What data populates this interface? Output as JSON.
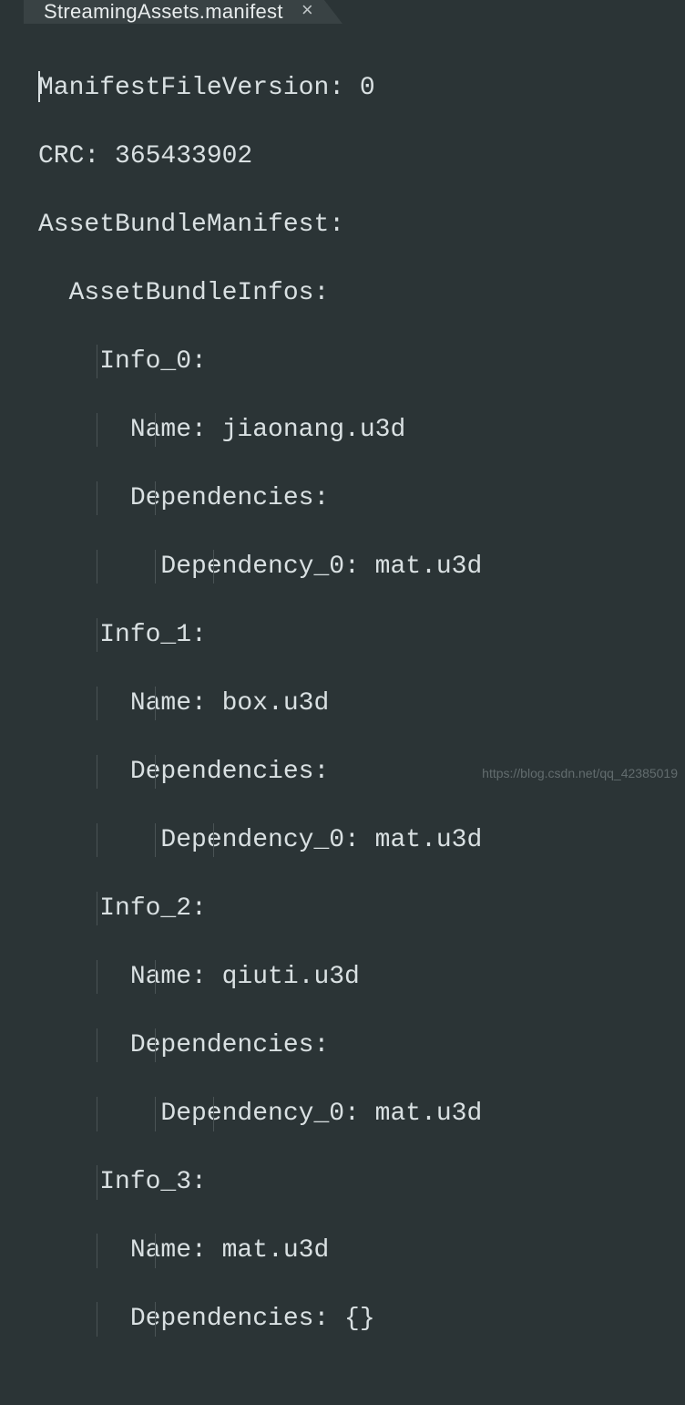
{
  "tab": {
    "title": "StreamingAssets.manifest",
    "close_icon": "×"
  },
  "content": {
    "l1": "ManifestFileVersion: 0",
    "l2": "CRC: 365433902",
    "l3": "AssetBundleManifest:",
    "l4": "  AssetBundleInfos:",
    "l5": "    Info_0:",
    "l6": "      Name: jiaonang.u3d",
    "l7": "      Dependencies:",
    "l8": "        Dependency_0: mat.u3d",
    "l9": "    Info_1:",
    "l10": "      Name: box.u3d",
    "l11": "      Dependencies:",
    "l12": "        Dependency_0: mat.u3d",
    "l13": "    Info_2:",
    "l14": "      Name: qiuti.u3d",
    "l15": "      Dependencies:",
    "l16": "        Dependency_0: mat.u3d",
    "l17": "    Info_3:",
    "l18": "      Name: mat.u3d",
    "l19": "      Dependencies: {}"
  },
  "watermark": "https://blog.csdn.net/qq_42385019"
}
